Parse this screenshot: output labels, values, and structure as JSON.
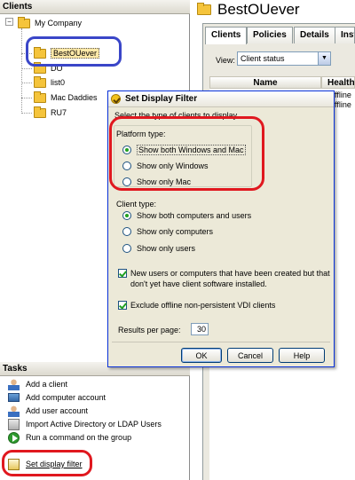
{
  "clients_pane": {
    "header": "Clients",
    "tree": {
      "root": "My Company",
      "children": [
        "BestOUever",
        "DO",
        "list0",
        "Mac Daddies",
        "RU7"
      ],
      "selected": "BestOUever"
    }
  },
  "tasks_pane": {
    "header": "Tasks",
    "items": [
      {
        "label": "Add a client",
        "icon": "user-icon"
      },
      {
        "label": "Add computer account",
        "icon": "computer-icon"
      },
      {
        "label": "Add user account",
        "icon": "user-icon"
      },
      {
        "label": "Import Active Directory or LDAP Users",
        "icon": "import-icon"
      },
      {
        "label": "Run a command on the group",
        "icon": "run-icon"
      },
      {
        "label": "Set display filter",
        "icon": "filter-icon"
      }
    ]
  },
  "right_pane": {
    "title": "BestOUever",
    "tabs": [
      "Clients",
      "Policies",
      "Details",
      "Inst"
    ],
    "active_tab": "Clients",
    "view_label": "View:",
    "view_value": "Client status",
    "columns": [
      "Name",
      "Health S"
    ],
    "rows": [
      "ffline",
      "ffline"
    ]
  },
  "dialog": {
    "title": "Set Display Filter",
    "instruction": "Select the type of clients to display.",
    "platform_type": {
      "label": "Platform type:",
      "options": [
        "Show both Windows and Mac",
        "Show only Windows",
        "Show only Mac"
      ],
      "selected": "Show both Windows and Mac"
    },
    "client_type": {
      "label": "Client type:",
      "options": [
        "Show both computers and users",
        "Show only computers",
        "Show only users"
      ],
      "selected": "Show both computers and users"
    },
    "checkboxes": [
      {
        "label": "New users or computers that have been created but that don't yet have client software installed.",
        "checked": true
      },
      {
        "label": "Exclude offline non-persistent VDI clients",
        "checked": true
      }
    ],
    "results_per_page_label": "Results per page:",
    "results_per_page": "30",
    "buttons": {
      "ok": "OK",
      "cancel": "Cancel",
      "help": "Help"
    }
  },
  "colors": {
    "annotation_blue": "#3a46c8",
    "annotation_red": "#e0181f",
    "selection_bg": "#ffe9a8",
    "folder_yellow": "#f5c43b"
  }
}
